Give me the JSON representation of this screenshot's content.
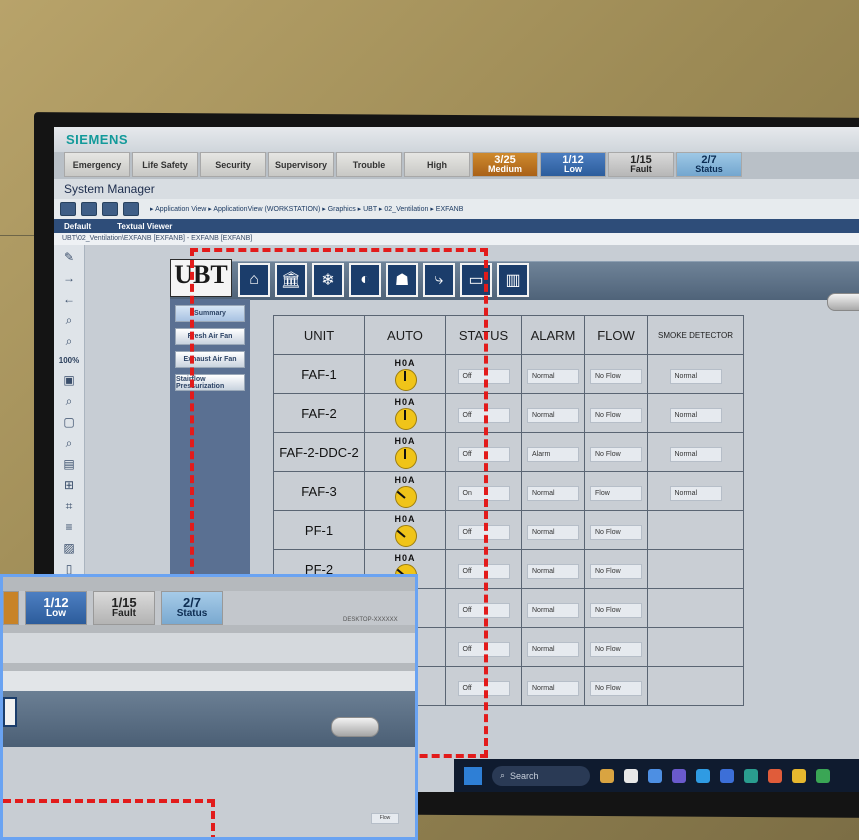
{
  "app": {
    "brand": "SIEMENS",
    "title": "System Manager"
  },
  "alarm_bar": {
    "categories": [
      "Emergency",
      "Life Safety",
      "Security",
      "Supervisory",
      "Trouble",
      "High"
    ],
    "counters": [
      {
        "count": "3/25",
        "label": "Medium",
        "color": "#c17a25"
      },
      {
        "count": "1/12",
        "label": "Low",
        "color": "#3a6db0"
      },
      {
        "count": "1/15",
        "label": "Fault",
        "color": "#c6c6c6"
      },
      {
        "count": "2/7",
        "label": "Status",
        "color": "#8ab8dc"
      }
    ]
  },
  "toolbar": {
    "path": "▸ Application View ▸ ApplicationView (WORKSTATION) ▸ Graphics ▸ UBT ▸ 02_Ventilation ▸ EXFANB"
  },
  "tabs": [
    "Default",
    "Textual Viewer"
  ],
  "crumb": "UBT\\02_Ventilation\\EXFANB [EXFANB]  -  EXFANB [EXFANB]",
  "left_toolbar": {
    "zoom": "100%"
  },
  "graphic": {
    "logo": "UBT",
    "nav_icons": [
      "home-icon",
      "building-icon",
      "snowflake-icon",
      "fan-icon",
      "person-icon",
      "faucet-icon",
      "panel-icon",
      "city-icon"
    ],
    "side_buttons": [
      "Summary",
      "Fresh Air Fan",
      "Exhaust Air Fan",
      "Stairflow Pressurization"
    ],
    "table": {
      "headers": [
        "UNIT",
        "AUTO",
        "STATUS",
        "ALARM",
        "FLOW",
        "SMOKE DETECTOR"
      ],
      "hoa_label": "H0A",
      "rows": [
        {
          "unit": "FAF-1",
          "status": "Off",
          "alarm": "Normal",
          "flow": "No Flow",
          "smoke": "Normal",
          "switch": "auto"
        },
        {
          "unit": "FAF-2",
          "status": "Off",
          "alarm": "Normal",
          "flow": "No Flow",
          "smoke": "Normal",
          "switch": "auto"
        },
        {
          "unit": "FAF-2-DDC-2",
          "status": "Off",
          "alarm": "Alarm",
          "flow": "No Flow",
          "smoke": "Normal",
          "switch": "auto"
        },
        {
          "unit": "FAF-3",
          "status": "On",
          "alarm": "Normal",
          "flow": "Flow",
          "smoke": "Normal",
          "switch": "hand"
        },
        {
          "unit": "PF-1",
          "status": "Off",
          "alarm": "Normal",
          "flow": "No Flow",
          "smoke": "",
          "switch": "hand"
        },
        {
          "unit": "PF-2",
          "status": "Off",
          "alarm": "Normal",
          "flow": "No Flow",
          "smoke": "",
          "switch": "hand"
        },
        {
          "unit": "",
          "status": "Off",
          "alarm": "Normal",
          "flow": "No Flow",
          "smoke": "",
          "switch": ""
        },
        {
          "unit": "",
          "status": "Off",
          "alarm": "Normal",
          "flow": "No Flow",
          "smoke": "",
          "switch": ""
        },
        {
          "unit": "",
          "status": "Off",
          "alarm": "Normal",
          "flow": "No Flow",
          "smoke": "",
          "switch": ""
        }
      ]
    }
  },
  "taskbar": {
    "search": "Search"
  },
  "inset": {
    "counters": [
      {
        "count": "1/12",
        "label": "Low"
      },
      {
        "count": "1/15",
        "label": "Fault"
      },
      {
        "count": "2/7",
        "label": "Status"
      }
    ],
    "host": "DESKTOP-XXXXXX",
    "flow": "Flow"
  },
  "highlight_color": "#e21b1b"
}
